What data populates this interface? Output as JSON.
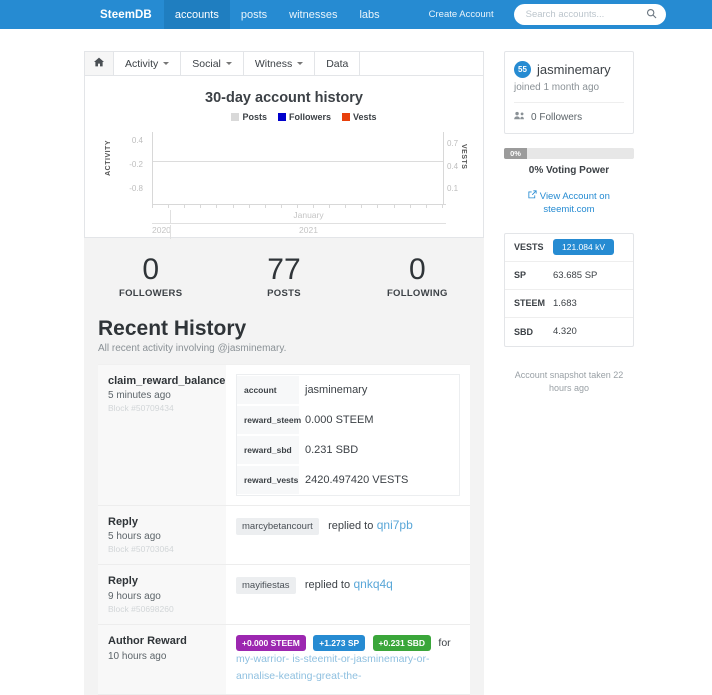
{
  "navbar": {
    "brand": "SteemDB",
    "links": [
      {
        "label": "accounts",
        "active": true
      },
      {
        "label": "posts",
        "active": false
      },
      {
        "label": "witnesses",
        "active": false
      },
      {
        "label": "labs",
        "active": false
      }
    ],
    "create_account": "Create Account",
    "search": {
      "placeholder": "Search accounts...",
      "value": "",
      "icon": "search-icon"
    }
  },
  "toolbar": {
    "home_icon": "home-icon",
    "items": [
      {
        "label": "Activity",
        "dropdown": true
      },
      {
        "label": "Social",
        "dropdown": true
      },
      {
        "label": "Witness",
        "dropdown": true
      },
      {
        "label": "Data",
        "dropdown": false
      }
    ]
  },
  "chart_data": {
    "type": "line",
    "title": "30-day account history",
    "xlabel": "",
    "ylabel": "ACTIVITY",
    "y2label": "VESTS",
    "grid": false,
    "legend_position": "top",
    "legend": [
      {
        "name": "Posts",
        "color": "#d9d9d9"
      },
      {
        "name": "Followers",
        "color": "#0000cc"
      },
      {
        "name": "Vests",
        "color": "#e8400c"
      }
    ],
    "yticks": [
      "0.4",
      "-0.2",
      "-0.8"
    ],
    "ylim": [
      -1.1,
      0.7
    ],
    "y2ticks": [
      "0.7",
      "0.4",
      "0.1"
    ],
    "y2lim": [
      0.0,
      0.85
    ],
    "xtick_groups": [
      {
        "label": "January",
        "parent": "2021"
      }
    ],
    "xyears": [
      "2020",
      "2021"
    ],
    "series": [
      {
        "name": "Posts",
        "values": []
      },
      {
        "name": "Followers",
        "values": []
      },
      {
        "name": "Vests",
        "values": []
      }
    ]
  },
  "stats": [
    {
      "number": "0",
      "label": "FOLLOWERS"
    },
    {
      "number": "77",
      "label": "POSTS"
    },
    {
      "number": "0",
      "label": "FOLLOWING"
    }
  ],
  "recent_history": {
    "title": "Recent History",
    "subtitle": "All recent activity involving @jasminemary."
  },
  "history": [
    {
      "op": "claim_reward_balance",
      "ago": "5 minutes ago",
      "block": "Block #50709434",
      "kind": "kv",
      "rows": [
        {
          "key": "account",
          "value": "jasminemary"
        },
        {
          "key": "reward_steem",
          "value": "0.000 STEEM"
        },
        {
          "key": "reward_sbd",
          "value": "0.231 SBD"
        },
        {
          "key": "reward_vests",
          "value": "2420.497420 VESTS"
        }
      ]
    },
    {
      "op": "Reply",
      "ago": "5 hours ago",
      "block": "Block #50703064",
      "kind": "reply",
      "author": "marcybetancourt",
      "verb": "replied to",
      "target": "qni7pb"
    },
    {
      "op": "Reply",
      "ago": "9 hours ago",
      "block": "Block #50698260",
      "kind": "reply",
      "author": "mayifiestas",
      "verb": "replied to",
      "target": "qnkq4q"
    },
    {
      "op": "Author Reward",
      "ago": "10 hours ago",
      "block": "",
      "kind": "reward",
      "badges": [
        {
          "label": "+0.000 STEEM",
          "color": "#9c27b0"
        },
        {
          "label": "+1.273 SP",
          "color": "#268bd2"
        },
        {
          "label": "+0.231 SBD",
          "color": "#3aa63a"
        }
      ],
      "for_word": "for",
      "permlink_line1": "my-warrior-",
      "permlink_line2": "is-steemit-or-jasminemary-or-annalise-keating-great-the-"
    }
  ],
  "sidebar": {
    "profile": {
      "reputation": "55",
      "username": "jasminemary",
      "joined": "joined 1 month ago",
      "followers": "0 Followers",
      "followers_icon": "people-icon"
    },
    "voting_power": {
      "percent_label": "0%",
      "caption": "0% Voting Power",
      "value": 0
    },
    "view_account": {
      "line1": "View Account on",
      "line2": "steemit.com",
      "icon": "external-link-icon"
    },
    "balances": [
      {
        "key": "VESTS",
        "value": "121.084 kV",
        "highlight": true
      },
      {
        "key": "SP",
        "value": "63.685 SP",
        "highlight": false
      },
      {
        "key": "STEEM",
        "value": "1.683",
        "highlight": false
      },
      {
        "key": "SBD",
        "value": "4.320",
        "highlight": false
      }
    ],
    "snapshot": "Account snapshot taken 22 hours ago"
  },
  "colors": {
    "brand_blue": "#268bd2",
    "active_nav": "#1f7ec0",
    "link": "#5aa7d8"
  }
}
